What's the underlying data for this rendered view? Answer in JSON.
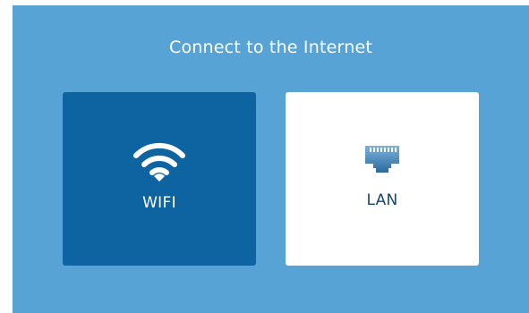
{
  "page": {
    "title": "Connect to the Internet"
  },
  "options": [
    {
      "label": "WIFI",
      "icon": "wifi-icon",
      "selected": true
    },
    {
      "label": "LAN",
      "icon": "ethernet-port-icon",
      "selected": false
    }
  ],
  "colors": {
    "background": "#57a3d6",
    "selected_card": "#0e63a1",
    "unselected_card": "#ffffff",
    "lan_label": "#16466f",
    "lan_icon_top": "#7fb2dc",
    "lan_icon_bottom": "#2a6a9e"
  }
}
